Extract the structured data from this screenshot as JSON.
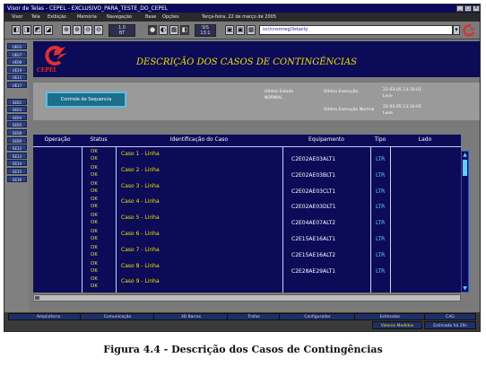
{
  "window": {
    "title": "Visor de Telas - CEPEL - EXCLUSIVO_PARA_TESTE_DO_CEPEL",
    "controls": [
      "_",
      "□",
      "X"
    ]
  },
  "menu": [
    "Visor",
    "Tela",
    "Exibição",
    "Memória",
    "Navegação",
    "Base",
    "Opções",
    "Terça-feira, 22 de março de 2005"
  ],
  "toolbar": {
    "tools_left": [
      "◧",
      "◨",
      "◩",
      "◪"
    ],
    "zoom_tools": [
      "⊕",
      "⊕",
      "⊖",
      "⊖"
    ],
    "scale1": {
      "top": "1.0",
      "bottom": "BT"
    },
    "tools_mid": [
      "●",
      "◐",
      "▦",
      "◧"
    ],
    "scale2": {
      "top": "SIS",
      "bottom": "13:1"
    },
    "tools_right": [
      "▣",
      "▣",
      "▦"
    ],
    "path": "scr/cnsmreg/listacty",
    "colors": {
      "accent": "#0b0b58",
      "logo_red": "#e03030"
    }
  },
  "sidebar": [
    "UE01",
    "UE07",
    "UE08",
    "UE10",
    "UE11",
    "UE17",
    "SE02",
    "SE03",
    "SE04",
    "SE05",
    "SE08",
    "SE09",
    "SE12",
    "SE13",
    "SE14",
    "SE15",
    "SE16"
  ],
  "header": {
    "brand": "CEPEL",
    "title": "DESCRIÇÃO DOS CASOS DE CONTINGÊNCIAS"
  },
  "info": {
    "button": "Controle de Sequencia",
    "ultimo_estado_label": "Último Estado",
    "ultimo_estado_value": "NORMAL",
    "ultima_exec_label": "Última Execução",
    "ultima_exec_value": "22-03-05 13:10:01",
    "ultima_exec_sub": "Leve",
    "ultima_exec_normal_label": "Última Execução Normal",
    "ultima_exec_normal_value": "22-03-05 13:10:01",
    "ultima_exec_normal_sub": "Leve"
  },
  "table": {
    "headers": [
      "Operação",
      "Status",
      "Identificação do Caso",
      "Equipamento",
      "Tipo",
      "Lado"
    ],
    "rows": [
      {
        "status": [
          "OK",
          "OK"
        ],
        "caso": "Caso 1 - Linha",
        "equip": "C2E02AE03ALT1",
        "tipo": "LTR"
      },
      {
        "status": [
          "OK",
          "OK"
        ],
        "caso": "Caso 2 - Linha",
        "equip": "C2E02AE03BLT1",
        "tipo": "LTR"
      },
      {
        "status": [
          "OK",
          "OK"
        ],
        "caso": "Caso 3 - Linha",
        "equip": "C2E02AE03CLT1",
        "tipo": "LTR"
      },
      {
        "status": [
          "OK",
          "OK"
        ],
        "caso": "Caso 4 - Linha",
        "equip": "C2E02AE03DLT1",
        "tipo": "LTR"
      },
      {
        "status": [
          "OK",
          "OK"
        ],
        "caso": "Caso 5 - Linha",
        "equip": "C2E04AE07ALT2",
        "tipo": "LTR"
      },
      {
        "status": [
          "OK",
          "OK"
        ],
        "caso": "Caso 6 - Linha",
        "equip": "C2E15AE16ALT1",
        "tipo": "LTR"
      },
      {
        "status": [
          "OK",
          "OK"
        ],
        "caso": "Caso 7 - Linha",
        "equip": "C2E15AE16ALT2",
        "tipo": "LTR"
      },
      {
        "status": [
          "OK",
          "OK"
        ],
        "caso": "Caso 8 - Linha",
        "equip": "C2E28AE29ALT1",
        "tipo": "LTR"
      },
      {
        "status": [
          "OK",
          "OK"
        ],
        "caso": "Caso 9 - Linha",
        "equip": "",
        "tipo": ""
      }
    ]
  },
  "statusbar": {
    "items": [
      "Ampliaferra",
      "Comunicação",
      "3D Barras",
      "Trafos",
      "Configurador",
      "Estimador",
      "CAG"
    ],
    "items2": [
      "Valores Medidos",
      "Estimado há 29s"
    ]
  },
  "caption": "Figura 4.4 - Descrição dos Casos de Contingências"
}
